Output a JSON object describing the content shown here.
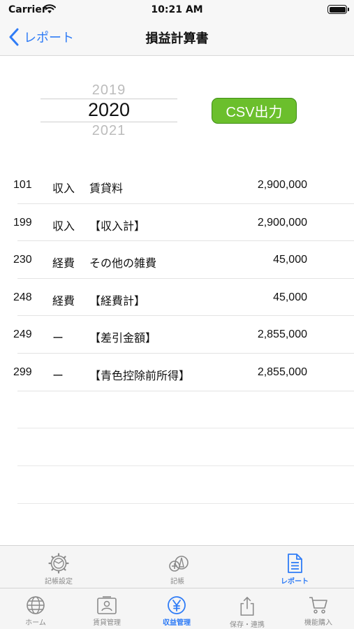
{
  "status": {
    "carrier": "Carrier",
    "time": "10:21 AM"
  },
  "nav": {
    "back_label": "レポート",
    "title": "損益計算書"
  },
  "picker": {
    "prev_year": "2019",
    "selected_year": "2020",
    "next_year": "2021"
  },
  "csv_button": "CSV出力",
  "rows": [
    {
      "code": "101",
      "kind": "収入",
      "name": "賃貸料",
      "amount": "2,900,000"
    },
    {
      "code": "199",
      "kind": "収入",
      "name": "【収入計】",
      "amount": "2,900,000"
    },
    {
      "code": "230",
      "kind": "経費",
      "name": "その他の雑費",
      "amount": "45,000"
    },
    {
      "code": "248",
      "kind": "経費",
      "name": "【経費計】",
      "amount": "45,000"
    },
    {
      "code": "249",
      "kind": "ー",
      "name": "【差引金額】",
      "amount": "2,855,000"
    },
    {
      "code": "299",
      "kind": "ー",
      "name": "【青色控除前所得】",
      "amount": "2,855,000"
    }
  ],
  "sub_tabs": [
    {
      "label": "記帳設定",
      "icon": "gear-icon",
      "active": false
    },
    {
      "label": "記帳",
      "icon": "add-record-icon",
      "active": false
    },
    {
      "label": "レポート",
      "icon": "report-icon",
      "active": true
    }
  ],
  "tabs": [
    {
      "label": "ホーム",
      "icon": "globe-icon",
      "active": false
    },
    {
      "label": "賃貸管理",
      "icon": "contact-card-icon",
      "active": false
    },
    {
      "label": "収益管理",
      "icon": "yen-icon",
      "active": true
    },
    {
      "label": "保存・連携",
      "icon": "share-icon",
      "active": false
    },
    {
      "label": "機能購入",
      "icon": "cart-icon",
      "active": false
    }
  ],
  "colors": {
    "accent": "#2f7cf6",
    "csv_green": "#6bbf2c",
    "inactive": "#8a8a8a"
  }
}
